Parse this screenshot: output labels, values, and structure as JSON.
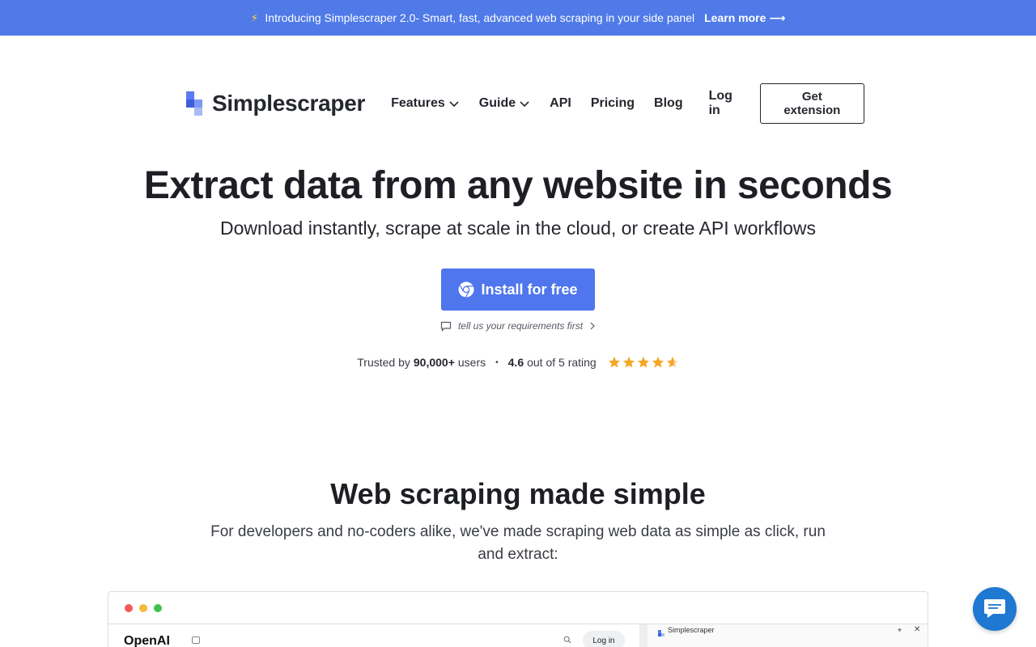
{
  "banner": {
    "bolt": "⚡",
    "text": "Introducing Simplescraper 2.0- Smart, fast, advanced web scraping in your side panel",
    "learn_more": "Learn more",
    "arrow": "⟶"
  },
  "nav": {
    "logo_text": "Simplescraper",
    "items": [
      {
        "label": "Features",
        "dropdown": true
      },
      {
        "label": "Guide",
        "dropdown": true
      },
      {
        "label": "API",
        "dropdown": false
      },
      {
        "label": "Pricing",
        "dropdown": false
      },
      {
        "label": "Blog",
        "dropdown": false
      }
    ],
    "login": "Log in",
    "cta": "Get extension"
  },
  "hero": {
    "title": "Extract data from any website in seconds",
    "subtitle": "Download instantly, scrape at scale in the cloud, or create API workflows",
    "install_label": "Install for free",
    "requirements_link": "tell us your requirements first",
    "trust": {
      "prefix": "Trusted by",
      "users": "90,000+",
      "users_suffix": "users",
      "separator": "•",
      "rating": "4.6",
      "rating_suffix": "out of 5 rating",
      "stars": 4.6
    }
  },
  "section": {
    "title": "Web scraping made simple",
    "subtitle": "For developers and no-coders alike, we've made scraping web data as simple as click, run and extract:"
  },
  "demo": {
    "site_name": "OpenAI",
    "login": "Log in",
    "panel_title": "Simplescraper",
    "pin": "⌖",
    "close": "✕"
  },
  "colors": {
    "banner": "#4f7ae8",
    "primary": "#4f76ec",
    "star": "#f5a623",
    "chat": "#1f78d1"
  }
}
